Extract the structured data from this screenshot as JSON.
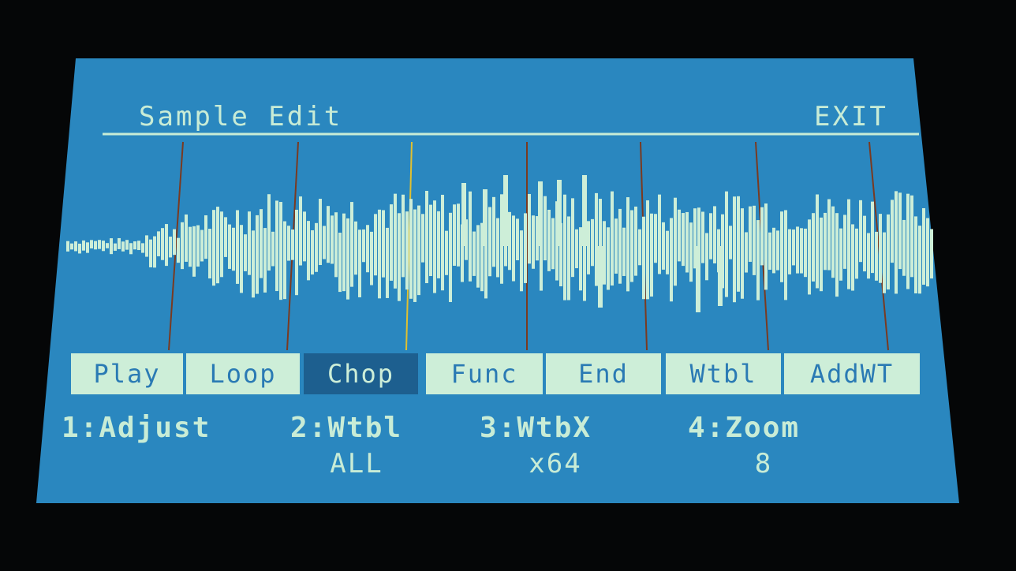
{
  "header": {
    "title": "Sample Edit",
    "exit_label": "EXIT"
  },
  "tabs": [
    {
      "label": "Play",
      "active": false
    },
    {
      "label": "Loop",
      "active": false
    },
    {
      "label": "Chop",
      "active": true
    },
    {
      "label": "Func",
      "active": false
    },
    {
      "label": "End",
      "active": false
    },
    {
      "label": "Wtbl",
      "active": false
    },
    {
      "label": "AddWT",
      "active": false
    }
  ],
  "params": [
    {
      "label": "1:Adjust",
      "value": ""
    },
    {
      "label": "2:Wtbl",
      "value": "ALL"
    },
    {
      "label": "3:WtbX",
      "value": "x64"
    },
    {
      "label": "4:Zoom",
      "value": "8"
    }
  ],
  "colors": {
    "lcd_background": "#2a87bf",
    "text": "#c8ecd6",
    "tab_background": "#cdeed8",
    "tab_active_background": "#1d5f8f",
    "marker": "#7a3a20",
    "marker_selected": "#e0c030",
    "waveform": "#cdeed8"
  }
}
